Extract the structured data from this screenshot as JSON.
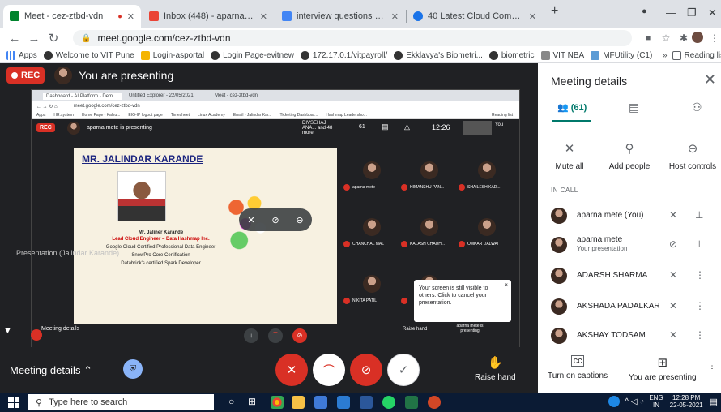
{
  "browser": {
    "tabs": [
      {
        "title": "Meet - cez-ztbd-vdn",
        "fav": "#00832d"
      },
      {
        "title": "Inbox (448) - aparna.mete@vit.edu",
        "fav": "#ea4335"
      },
      {
        "title": "interview questions on database",
        "fav": "#4285f4"
      },
      {
        "title": "40 Latest Cloud Computing Inter",
        "fav": "#1a73e8"
      }
    ],
    "new_tab": "+",
    "url": "meet.google.com/cez-ztbd-vdn",
    "bookmarks": [
      "Apps",
      "Welcome to VIT Pune",
      "Login-asportal",
      "Login Page-evitnew",
      "172.17.0.1/vitpayroll/",
      "Ekklavya's Biometri...",
      "biometric",
      "VIT NBA",
      "MFUtility (C1)"
    ],
    "reading_list": "Reading list"
  },
  "presenting": {
    "rec": "REC",
    "text": "You are presenting"
  },
  "inner": {
    "url": "meet.google.com/cez-ztbd-vdn",
    "rec": "REC",
    "presenter": "aparna mete is presenting",
    "others": "DIVSEHAJ ANA... and 48 more",
    "count": "61",
    "time": "12:26",
    "tabs": [
      "Dashboard - AI Platform - Dem",
      "Untitled Explorer - 22/05/2021",
      "Meet - cez-ztbd-vdn"
    ],
    "bookmarks": [
      "Apps",
      "HR.system",
      "Home Page - Kalvu...",
      "EIG-IP logout page",
      "Timesheet",
      "Linux Academy",
      "Email - Jalindar Kar...",
      "Ticketing Dashboar...",
      "Hashmap Leadersho..."
    ],
    "reading_list": "Reading list",
    "you_label": "You",
    "raise_hand": "Raise hand",
    "is_presenting": "aparna mete is presenting",
    "slide": {
      "title": "MR. JALINDAR KARANDE",
      "name": "Mr. Jaliner Karande",
      "role": "Lead Cloud Engineer – Data Hashmap Inc.",
      "cert1": "Google Cloud Certified Professional Data Engineer",
      "cert2": "SnowPro Core Certification",
      "cert3": "Databrick's certified Spark Developer"
    },
    "tiles": [
      "aparna mete",
      "HIMANSHU PAN...",
      "SHAILESH KAD...",
      "CHANCHAL MAL",
      "KALASH CHAUH...",
      "OMKAR DALWAI",
      "NIKITA PATIL",
      "",
      ""
    ],
    "tooltip": "Your screen is still visible to others. Click to cancel your presentation.",
    "tooltip_close": "×",
    "meeting_details": "Meeting details",
    "presentation_label": "Presentation (Jalindar Karande)"
  },
  "panel": {
    "title": "Meeting details",
    "people_count": "(61)",
    "actions": [
      "Mute all",
      "Add people",
      "Host controls"
    ],
    "in_call": "IN CALL",
    "people": [
      {
        "name": "aparna mete (You)",
        "sub": ""
      },
      {
        "name": "aparna mete",
        "sub": "Your presentation"
      },
      {
        "name": "ADARSH SHARMA",
        "sub": ""
      },
      {
        "name": "AKSHADA PADALKAR",
        "sub": ""
      },
      {
        "name": "AKSHAY TODSAM",
        "sub": ""
      }
    ]
  },
  "meetbar": {
    "details": "Meeting details",
    "raise_hand": "Raise hand",
    "captions": "Turn on captions",
    "presenting": "You are presenting"
  },
  "taskbar": {
    "search": "Type here to search",
    "lang": "ENG",
    "region": "IN",
    "time": "12:28 PM",
    "date": "22-05-2021"
  }
}
